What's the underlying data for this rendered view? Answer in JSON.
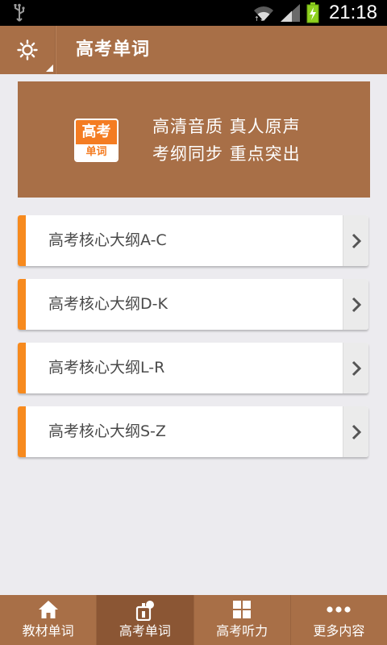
{
  "status_bar": {
    "time": "21:18"
  },
  "action_bar": {
    "title": "高考单词",
    "home_icon": "sun-icon"
  },
  "banner": {
    "logo_top": "高考",
    "logo_bottom": "单词",
    "line1": "高清音质  真人原声",
    "line2": "考纲同步  重点突出"
  },
  "list": [
    {
      "label": "高考核心大纲A-C"
    },
    {
      "label": "高考核心大纲D-K"
    },
    {
      "label": "高考核心大纲L-R"
    },
    {
      "label": "高考核心大纲S-Z"
    }
  ],
  "tabs": [
    {
      "label": "教材单词",
      "icon": "home-icon",
      "active": false
    },
    {
      "label": "高考单词",
      "icon": "exam-icon",
      "active": true
    },
    {
      "label": "高考听力",
      "icon": "grid-icon",
      "active": false
    },
    {
      "label": "更多内容",
      "icon": "more-dots-icon",
      "active": false
    }
  ],
  "colors": {
    "brand": "#a86f47",
    "accent": "#f78a1e",
    "logo": "#f47c22"
  }
}
